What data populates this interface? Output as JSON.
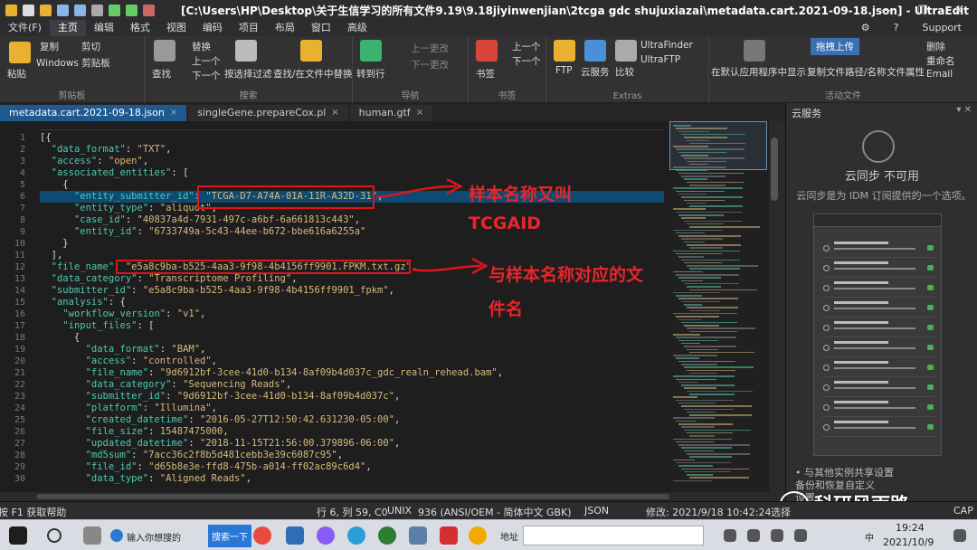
{
  "window": {
    "title": "[C:\\Users\\HP\\Desktop\\关于生信学习的所有文件9.19\\9.18jiyinwenjian\\2tcga gdc shujuxiazai\\metadata.cart.2021-09-18.json] - UltraEdit",
    "minimize": "—",
    "maximize": "❐",
    "close": "✕"
  },
  "menu": {
    "items": [
      "文件(F)",
      "主页",
      "编辑",
      "格式",
      "视图",
      "编码",
      "项目",
      "布局",
      "窗口",
      "高级"
    ],
    "active_index": 1,
    "right": [
      "⚙",
      "?",
      "Support"
    ]
  },
  "ribbon": {
    "clipboard": {
      "label": "剪贴板",
      "paste": "粘贴",
      "copy": "复制",
      "cut": "剪切",
      "windows_clipboard": "Windows 剪贴板"
    },
    "search": {
      "label": "搜索",
      "find": "查找",
      "replace": "替换",
      "up": "上一个",
      "down": "下一个",
      "filter": "按选择过滤",
      "find_in_files": "查找/在文件中替换"
    },
    "navigation": {
      "label": "导航",
      "goto": "转到行",
      "prev_change": "上一更改",
      "next_change": "下一更改"
    },
    "bookmarks": {
      "label": "书签",
      "bookmark": "书签",
      "prev": "上一个",
      "next": "下一个"
    },
    "extras": {
      "label": "Extras",
      "ftp": "FTP",
      "cloud": "云服务",
      "compare": "比较",
      "ultrafinder": "UltraFinder",
      "ultraftp": "UltraFTP"
    },
    "active_file": {
      "label": "活动文件",
      "show_in_app": "在默认应用程序中显示",
      "copy_path": "复制文件路径/名称",
      "properties": "文件属性",
      "delete": "删除",
      "rename": "重命名",
      "email": "Email"
    },
    "upload_button": "拖拽上传"
  },
  "tabs": [
    {
      "label": "metadata.cart.2021-09-18.json",
      "close": "×"
    },
    {
      "label": "singleGene.prepareCox.pl",
      "close": "×"
    },
    {
      "label": "human.gtf",
      "close": "×"
    }
  ],
  "editor": {
    "line_numbers": [
      "1",
      "2",
      "3",
      "4",
      "5",
      "6",
      "7",
      "8",
      "9",
      "10",
      "11",
      "12",
      "13",
      "14",
      "15",
      "16",
      "17",
      "18",
      "19",
      "20",
      "21",
      "22",
      "23",
      "24",
      "25",
      "26",
      "27",
      "28",
      "29",
      "30"
    ],
    "lines": [
      "[{",
      "  \"data_format\": \"TXT\",",
      "  \"access\": \"open\",",
      "  \"associated_entities\": [",
      "    {",
      "      \"entity_submitter_id\": \"TCGA-D7-A74A-01A-11R-A32D-31\",",
      "      \"entity_type\": \"aliquot\",",
      "      \"case_id\": \"40837a4d-7931-497c-a6bf-6a661813c443\",",
      "      \"entity_id\": \"6733749a-5c43-44ee-b672-bbe616a6255a\"",
      "    }",
      "  ],",
      "  \"file_name\": \"e5a8c9ba-b525-4aa3-9f98-4b4156ff9901.FPKM.txt.gz\",",
      "  \"data_category\": \"Transcriptome Profiling\",",
      "  \"submitter_id\": \"e5a8c9ba-b525-4aa3-9f98-4b4156ff9901_fpkm\",",
      "  \"analysis\": {",
      "    \"workflow_version\": \"v1\",",
      "    \"input_files\": [",
      "      {",
      "        \"data_format\": \"BAM\",",
      "        \"access\": \"controlled\",",
      "        \"file_name\": \"9d6912bf-3cee-41d0-b134-8af09b4d037c_gdc_realn_rehead.bam\",",
      "        \"data_category\": \"Sequencing Reads\",",
      "        \"submitter_id\": \"9d6912bf-3cee-41d0-b134-8af09b4d037c\",",
      "        \"platform\": \"Illumina\",",
      "        \"created_datetime\": \"2016-05-27T12:50:42.631230-05:00\",",
      "        \"file_size\": 15487475000,",
      "        \"updated_datetime\": \"2018-11-15T21:56:00.379896-06:00\",",
      "        \"md5sum\": \"7acc36c2f8b5d481cebb3e39c6087c95\",",
      "        \"file_id\": \"d65b8e3e-ffd8-475b-a014-ff02ac89c6d4\",",
      "        \"data_type\": \"Aligned Reads\","
    ],
    "highlighted_line": 6
  },
  "annotations": {
    "a1_line1": "样本名称又叫",
    "a1_line2": "TCGAID",
    "a2_line1": "与样本名称对应的文",
    "a2_line2": "件名"
  },
  "side_panel": {
    "title": "云服务",
    "controls": "▾ ✕",
    "heading": "云同步 不可用",
    "subtitle": "云同步是为 IDM 订阅提供的一个选项。",
    "list": [
      "• 与其他实例共享设置",
      "  备份和恢复自定义",
      "  设置"
    ]
  },
  "status": {
    "help": "按 F1 获取帮助",
    "position": "行 6, 列 59, C0",
    "line_ending": "UNIX",
    "codepage": "936  (ANSI/OEM - 简体中文 GBK)",
    "syntax": "JSON",
    "modified": "修改:  2021/9/18 10:42:24",
    "select": "选择",
    "caps": "CAP"
  },
  "taskbar": {
    "search_placeholder": "输入你想搜的",
    "search_btn": "搜索一下",
    "address_label": "地址",
    "time": "19:24",
    "date": "2021/10/9",
    "ime": "中"
  },
  "watermark": "科研风雨路",
  "colors": {
    "annotation_red": "#e0141a",
    "accent_blue": "#1e5a8e",
    "key_teal": "#4ec9b0",
    "string_gold": "#d7ba7d"
  }
}
